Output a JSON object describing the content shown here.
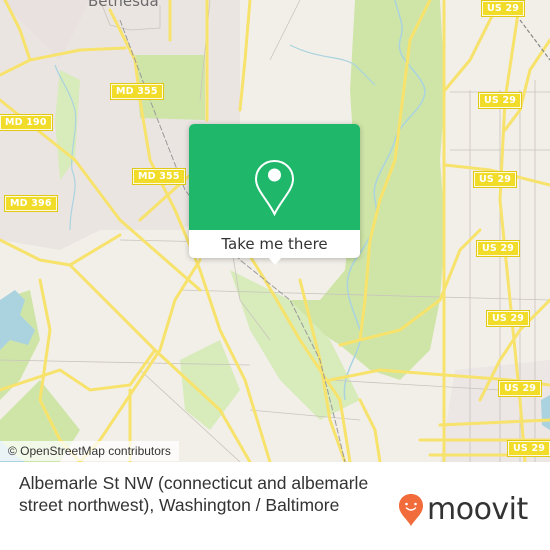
{
  "map": {
    "place_labels": [
      "Bethesda"
    ],
    "route_shields": [
      {
        "label": "MD 355"
      },
      {
        "label": "MD 355"
      },
      {
        "label": "MD 190"
      },
      {
        "label": "MD 396"
      },
      {
        "label": "US 29"
      },
      {
        "label": "US 29"
      },
      {
        "label": "US 29"
      },
      {
        "label": "US 29"
      },
      {
        "label": "US 29"
      },
      {
        "label": "US 29"
      },
      {
        "label": "US 29"
      }
    ],
    "attribution": "© OpenStreetMap contributors",
    "colors": {
      "land": "#f2efe9",
      "park": "#cfe5a8",
      "water": "#aad3df",
      "road_major": "#f7e26b",
      "road_minor": "#c9c4bc",
      "shield": "#f1dc2a"
    }
  },
  "popup": {
    "icon": "map-pin-icon",
    "button_label": "Take me there",
    "color": "#1fb86b"
  },
  "footer": {
    "title": "Albemarle St NW (connecticut and albemarle street northwest), Washington / Baltimore",
    "brand": "moovit",
    "brand_color": "#f26b3a"
  }
}
